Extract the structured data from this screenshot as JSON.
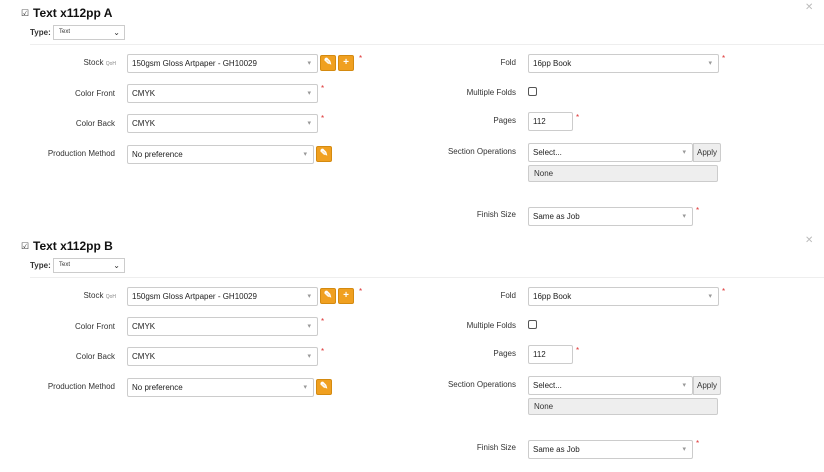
{
  "sections": [
    {
      "title": "Text x112pp A",
      "type_label": "Type:",
      "type_value": "Text",
      "stock_label": "Stock",
      "stock_sub": "QoH",
      "stock_value": "150gsm Gloss Artpaper - GH10029",
      "color_front_label": "Color Front",
      "color_front_value": "CMYK",
      "color_back_label": "Color Back",
      "color_back_value": "CMYK",
      "production_label": "Production Method",
      "production_value": "No preference",
      "fold_label": "Fold",
      "fold_value": "16pp Book",
      "multiple_folds_label": "Multiple Folds",
      "multiple_folds_checked": false,
      "pages_label": "Pages",
      "pages_value": "112",
      "section_ops_label": "Section Operations",
      "section_ops_placeholder": "Select...",
      "apply_label": "Apply",
      "section_ops_list": "None",
      "finish_size_label": "Finish Size",
      "finish_size_value": "Same as Job"
    },
    {
      "title": "Text x112pp B",
      "type_label": "Type:",
      "type_value": "Text",
      "stock_label": "Stock",
      "stock_sub": "QoH",
      "stock_value": "150gsm Gloss Artpaper - GH10029",
      "color_front_label": "Color Front",
      "color_front_value": "CMYK",
      "color_back_label": "Color Back",
      "color_back_value": "CMYK",
      "production_label": "Production Method",
      "production_value": "No preference",
      "fold_label": "Fold",
      "fold_value": "16pp Book",
      "multiple_folds_label": "Multiple Folds",
      "multiple_folds_checked": false,
      "pages_label": "Pages",
      "pages_value": "112",
      "section_ops_label": "Section Operations",
      "section_ops_placeholder": "Select...",
      "apply_label": "Apply",
      "section_ops_list": "None",
      "finish_size_label": "Finish Size",
      "finish_size_value": "Same as Job"
    }
  ],
  "required_mark": "*",
  "icons": {
    "edit": "edit-square-icon",
    "close": "close-icon",
    "wrench": "wrench-icon",
    "plus": "plus-icon",
    "caret": "caret-down-icon"
  },
  "colors": {
    "accent": "#f0a020",
    "required": "#dd3333"
  }
}
